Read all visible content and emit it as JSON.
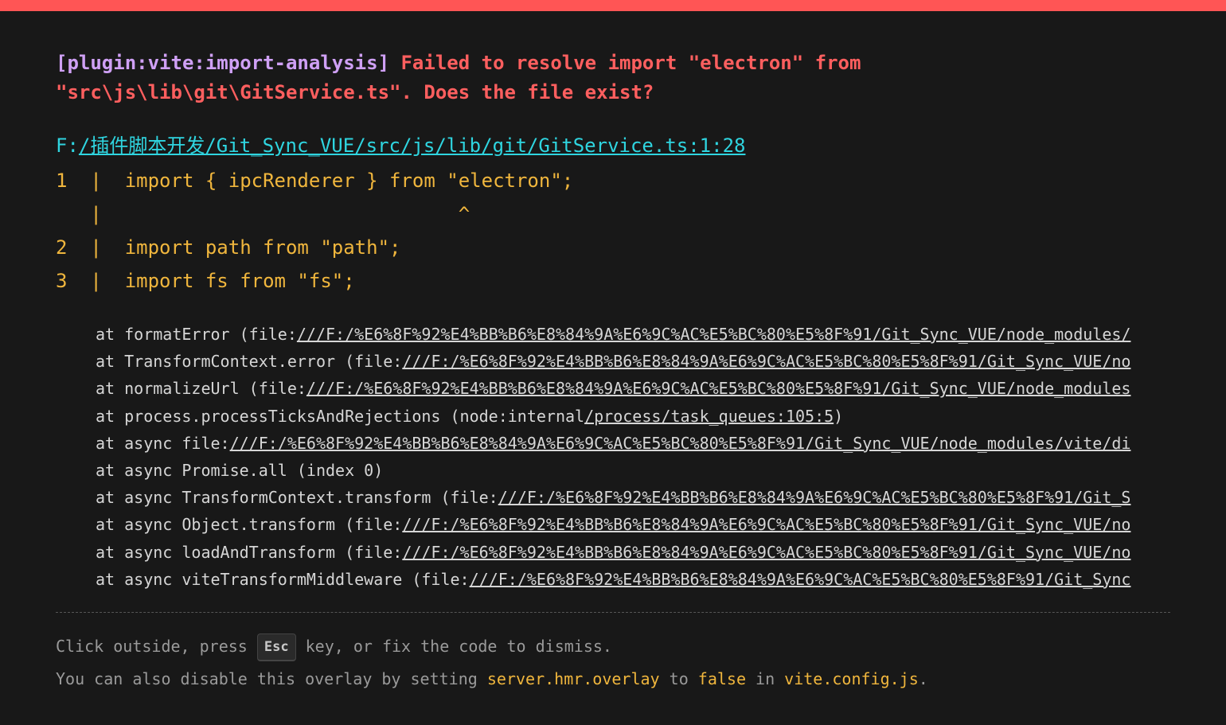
{
  "error": {
    "plugin": "[plugin:vite:import-analysis]",
    "message": "Failed to resolve import \"electron\" from \"src\\js\\lib\\git\\GitService.ts\". Does the file exist?",
    "file_prefix": "F:",
    "file_link": "/插件脚本开发/Git_Sync_VUE/src/js/lib/git/GitService.ts:1:28"
  },
  "frame": {
    "lines": [
      "1  |  import { ipcRenderer } from \"electron\";",
      "   |                               ^",
      "2  |  import path from \"path\";",
      "3  |  import fs from \"fs\";"
    ]
  },
  "stack": [
    {
      "prefix": "at formatError (file:",
      "link": "///F:/%E6%8F%92%E4%BB%B6%E8%84%9A%E6%9C%AC%E5%BC%80%E5%8F%91/Git_Sync_VUE/node_modules/"
    },
    {
      "prefix": "at TransformContext.error (file:",
      "link": "///F:/%E6%8F%92%E4%BB%B6%E8%84%9A%E6%9C%AC%E5%BC%80%E5%8F%91/Git_Sync_VUE/no"
    },
    {
      "prefix": "at normalizeUrl (file:",
      "link": "///F:/%E6%8F%92%E4%BB%B6%E8%84%9A%E6%9C%AC%E5%BC%80%E5%8F%91/Git_Sync_VUE/node_modules"
    },
    {
      "prefix": "at process.processTicksAndRejections (node:internal",
      "link": "/process/task_queues:105:5",
      "suffix": ")"
    },
    {
      "prefix": "at async file:",
      "link": "///F:/%E6%8F%92%E4%BB%B6%E8%84%9A%E6%9C%AC%E5%BC%80%E5%8F%91/Git_Sync_VUE/node_modules/vite/di"
    },
    {
      "prefix": "at async Promise.all (index 0)"
    },
    {
      "prefix": "at async TransformContext.transform (file:",
      "link": "///F:/%E6%8F%92%E4%BB%B6%E8%84%9A%E6%9C%AC%E5%BC%80%E5%8F%91/Git_S"
    },
    {
      "prefix": "at async Object.transform (file:",
      "link": "///F:/%E6%8F%92%E4%BB%B6%E8%84%9A%E6%9C%AC%E5%BC%80%E5%8F%91/Git_Sync_VUE/no"
    },
    {
      "prefix": "at async loadAndTransform (file:",
      "link": "///F:/%E6%8F%92%E4%BB%B6%E8%84%9A%E6%9C%AC%E5%BC%80%E5%8F%91/Git_Sync_VUE/no"
    },
    {
      "prefix": "at async viteTransformMiddleware (file:",
      "link": "///F:/%E6%8F%92%E4%BB%B6%E8%84%9A%E6%9C%AC%E5%BC%80%E5%8F%91/Git_Sync"
    }
  ],
  "tip": {
    "line1_before": "Click outside, press ",
    "key": "Esc",
    "line1_after": " key, or fix the code to dismiss.",
    "line2_a": "You can also disable this overlay by setting ",
    "line2_setting": "server.hmr.overlay",
    "line2_b": " to ",
    "line2_value": "false",
    "line2_c": " in ",
    "line2_file": "vite.config.js",
    "line2_d": "."
  },
  "colors": {
    "top_border": "#ff5555",
    "plugin": "#cfa0f5",
    "message": "#ff5f5f",
    "file_link": "#2fd5e0",
    "code_frame": "#f0b63d",
    "background": "#181818"
  }
}
